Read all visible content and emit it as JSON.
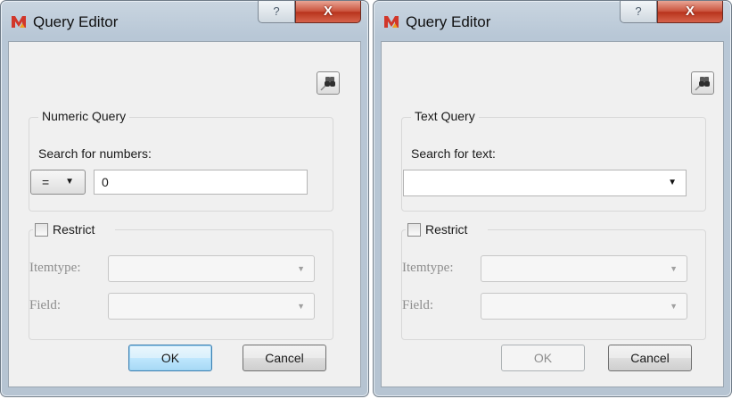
{
  "dialogs": [
    {
      "title": "Query Editor",
      "help_glyph": "?",
      "close_glyph": "X",
      "group_title": "Numeric Query",
      "search_label": "Search for numbers:",
      "operator": "=",
      "value": "0",
      "restrict_label": "Restrict",
      "restrict_checked": false,
      "itemtype_label": "Itemtype:",
      "field_label": "Field:",
      "ok_label": "OK",
      "cancel_label": "Cancel"
    },
    {
      "title": "Query Editor",
      "help_glyph": "?",
      "close_glyph": "X",
      "group_title": "Text Query",
      "search_label": "Search for text:",
      "value": "",
      "restrict_label": "Restrict",
      "restrict_checked": false,
      "itemtype_label": "Itemtype:",
      "field_label": "Field:",
      "ok_label": "OK",
      "cancel_label": "Cancel"
    }
  ],
  "icons": {
    "app": "app-logo-icon",
    "find": "binoculars-icon",
    "dropdown": "chevron-down-icon"
  },
  "colors": {
    "frame": "#b8c7d6",
    "close_button": "#c9503a",
    "default_button_border": "#3c7fb1",
    "app_icon": "#d1372a"
  }
}
